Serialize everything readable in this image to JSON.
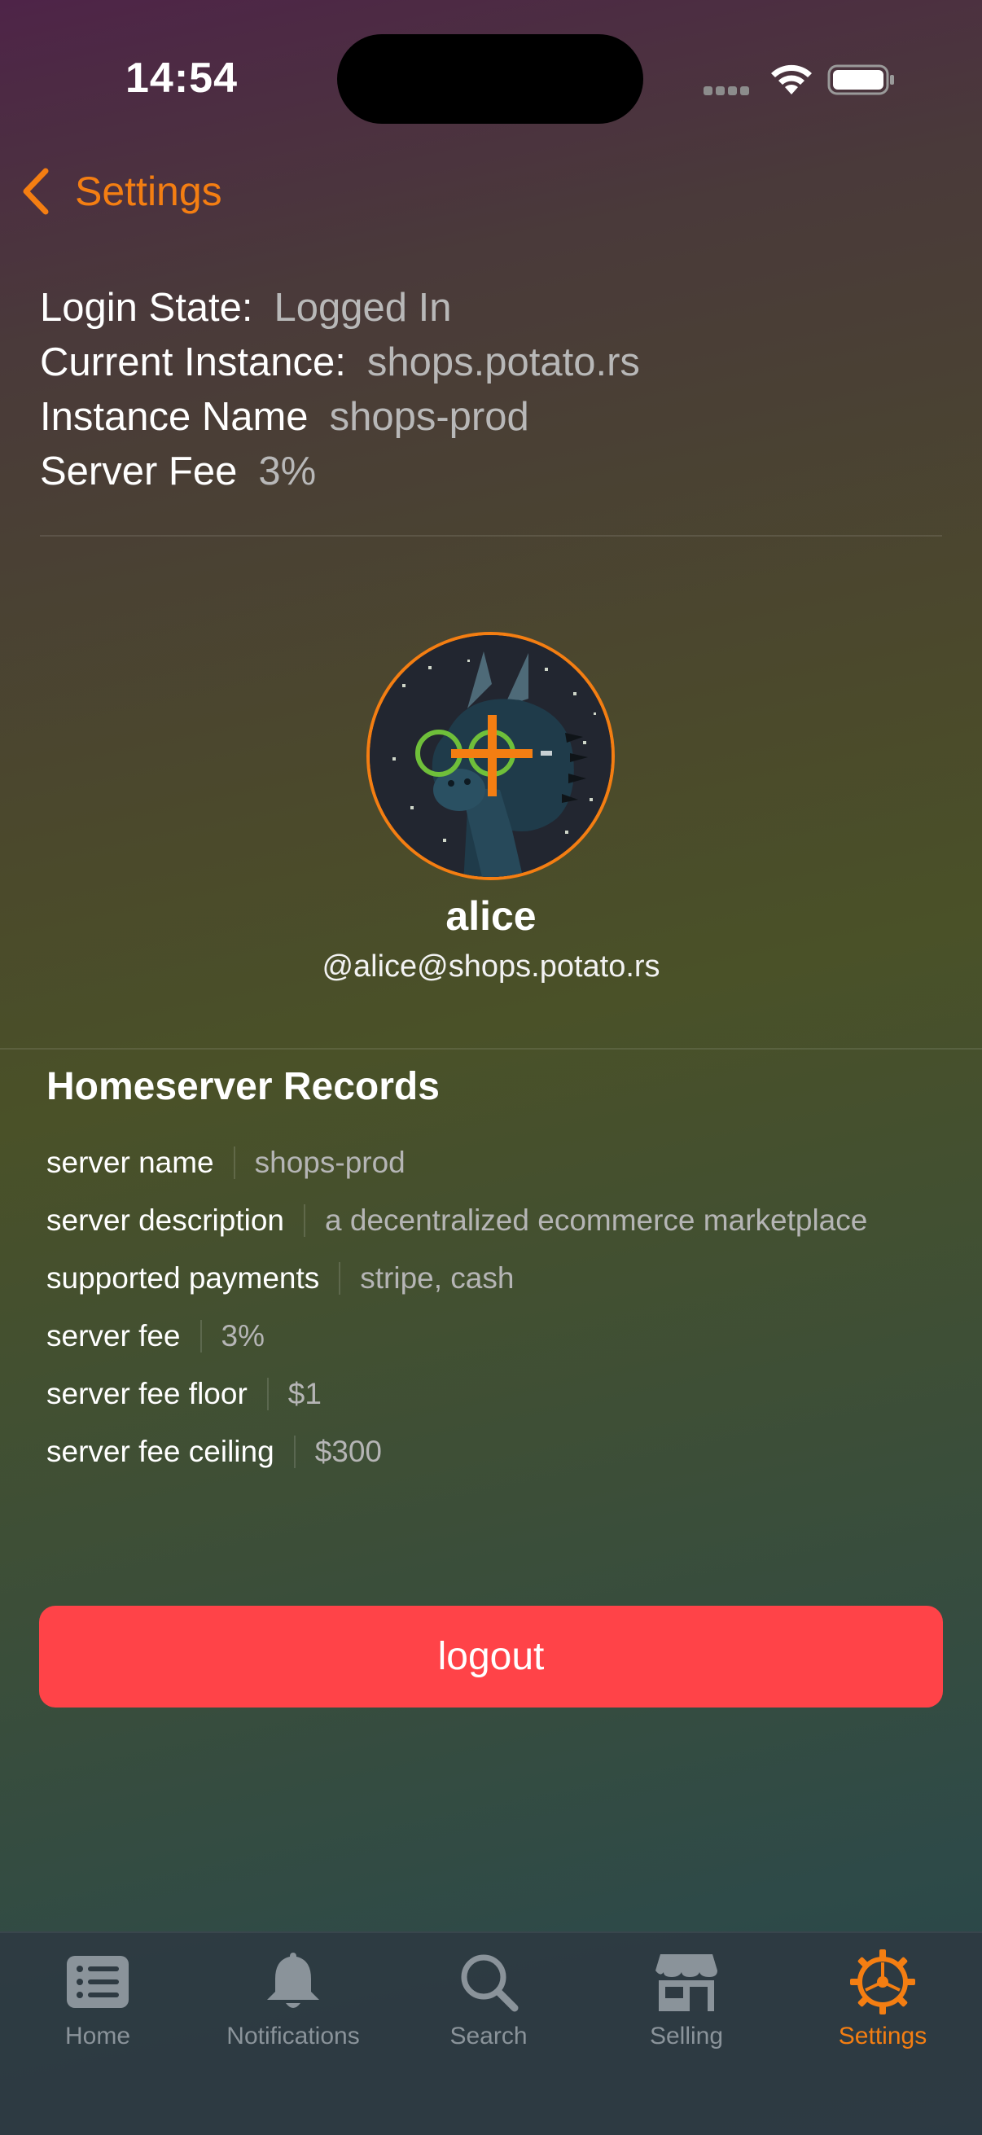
{
  "status_bar": {
    "time": "14:54"
  },
  "nav": {
    "back_label": "Settings"
  },
  "info": [
    {
      "label": "Login State:",
      "value": "Logged In"
    },
    {
      "label": "Current Instance:",
      "value": "shops.potato.rs"
    },
    {
      "label": "Instance Name",
      "value": "shops-prod"
    },
    {
      "label": "Server Fee",
      "value": "3%"
    }
  ],
  "profile": {
    "name": "alice",
    "handle": "@alice@shops.potato.rs"
  },
  "records": {
    "title": "Homeserver Records",
    "rows": [
      {
        "key": "server name",
        "value": "shops-prod"
      },
      {
        "key": "server description",
        "value": "a decentralized ecommerce marketplace"
      },
      {
        "key": "supported payments",
        "value": "stripe, cash"
      },
      {
        "key": "server fee",
        "value": "3%"
      },
      {
        "key": "server fee floor",
        "value": "$1"
      },
      {
        "key": "server fee ceiling",
        "value": "$300"
      }
    ]
  },
  "logout_label": "logout",
  "tabs": [
    {
      "label": "Home",
      "icon": "list-icon"
    },
    {
      "label": "Notifications",
      "icon": "bell-icon"
    },
    {
      "label": "Search",
      "icon": "magnifier-icon"
    },
    {
      "label": "Selling",
      "icon": "storefront-icon"
    },
    {
      "label": "Settings",
      "icon": "gear-icon",
      "active": true
    }
  ],
  "colors": {
    "accent": "#f47e12",
    "logout": "#ff4348",
    "muted_text": "#b8b8b8"
  }
}
